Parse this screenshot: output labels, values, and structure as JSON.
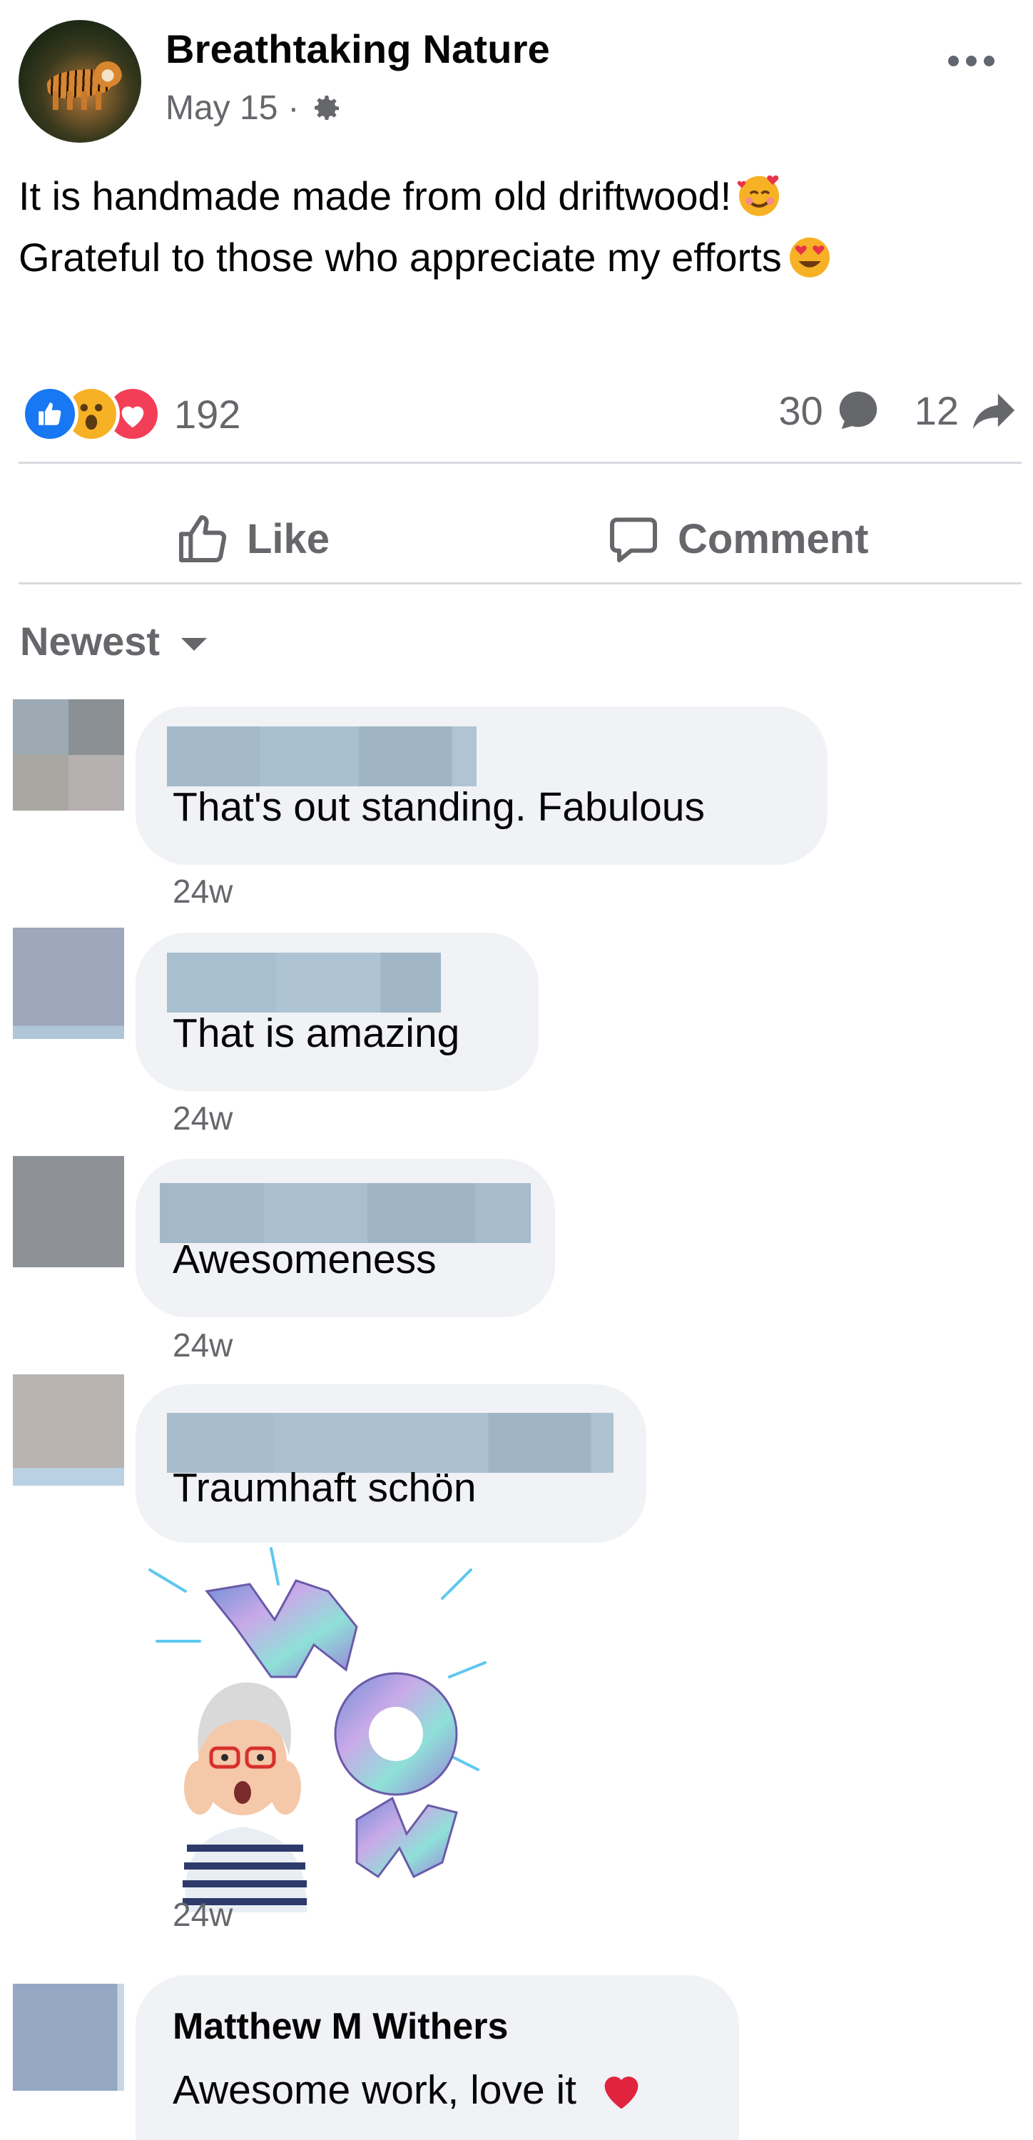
{
  "post": {
    "page_name": "Breathtaking Nature",
    "date": "May 15",
    "separator": "·",
    "text_line1": "It is handmade made from old driftwood!",
    "text_line2": "Grateful to those who appreciate my efforts",
    "reaction_count": "192",
    "comment_count": "30",
    "share_count": "12",
    "like_label": "Like",
    "comment_label": "Comment",
    "sort_label": "Newest",
    "icons": [
      "gear-icon",
      "more-icon",
      "like-reaction-icon",
      "wow-reaction-icon",
      "love-reaction-icon",
      "comment-bubble-icon",
      "share-arrow-icon",
      "thumbs-up-icon",
      "comment-icon",
      "chevron-down-icon"
    ]
  },
  "comments": [
    {
      "text": "That's out standing. Fabulous",
      "time": "24w"
    },
    {
      "text": "That is amazing",
      "time": "24w"
    },
    {
      "text": "Awesomeness",
      "time": "24w"
    },
    {
      "text": "Traumhaft schön",
      "time": "24w",
      "sticker": "wow-sticker"
    },
    {
      "author": "Matthew M Withers",
      "text": "Awesome work, love it"
    }
  ],
  "colors": {
    "primary_text": "#050505",
    "secondary_text": "#65676b",
    "bubble_bg": "#f0f2f5",
    "divider": "#d8dadf",
    "like_blue": "#1877f2",
    "love_red": "#f33e58",
    "wow_yellow": "#f7b125"
  }
}
